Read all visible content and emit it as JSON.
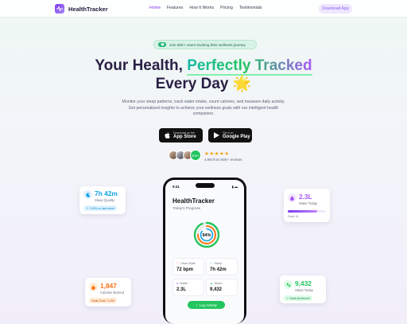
{
  "nav": {
    "brand": "HealthTracker",
    "links": [
      "Home",
      "Features",
      "How It Works",
      "Pricing",
      "Testimonials"
    ],
    "active_link": "Home",
    "cta": "Download App"
  },
  "hero": {
    "badge": "Join 50K+ users tracking their wellness journey",
    "title_line1_plain": "Your Health, ",
    "title_line1_highlight": "Perfectly Tracked",
    "title_line2": "Every Day",
    "title_emoji": "🌟",
    "subtitle": "Monitor your sleep patterns, track water intake, count calories, and measure daily activity. Get personalized insights to achieve your wellness goals with our intelligent health companion.",
    "app_store": {
      "small": "Download on the",
      "big": "App Store"
    },
    "google_play": {
      "small": "Get it on",
      "big": "Google Play"
    },
    "avatar_count": "50K+",
    "stars": "★★★★★",
    "rating_text": "4.9/5 from 50K+ reviews"
  },
  "phone": {
    "time": "9:41",
    "app_title": "HealthTracker",
    "app_subtitle": "Today's Progress",
    "progress_label": "94%",
    "progress_value": 0.94,
    "metrics": [
      {
        "label": "Heart Rate",
        "value": "72 bpm",
        "icon": "heart-icon"
      },
      {
        "label": "Sleep",
        "value": "7h 42m",
        "icon": "moon-icon"
      },
      {
        "label": "Water",
        "value": "2.3L",
        "icon": "drop-icon"
      },
      {
        "label": "Steps",
        "value": "9,432",
        "icon": "footsteps-icon"
      }
    ],
    "log_button": "Log Activity"
  },
  "cards": {
    "sleep": {
      "value": "7h 42m",
      "label": "Sleep Quality",
      "pill": "+15% vs last week",
      "color": "#0ea5e9"
    },
    "water": {
      "value": "2.3L",
      "label": "Water Today",
      "goal": "Goal: 3L",
      "progress": 0.77,
      "color": "#a855f7"
    },
    "calories": {
      "value": "1,847",
      "label": "Calories Burned",
      "pill": "Daily Goal: 2,200",
      "color": "#f97316"
    },
    "steps": {
      "value": "9,432",
      "label": "Steps Today",
      "pill": "Goal Achieved!",
      "color": "#22c55e"
    }
  }
}
